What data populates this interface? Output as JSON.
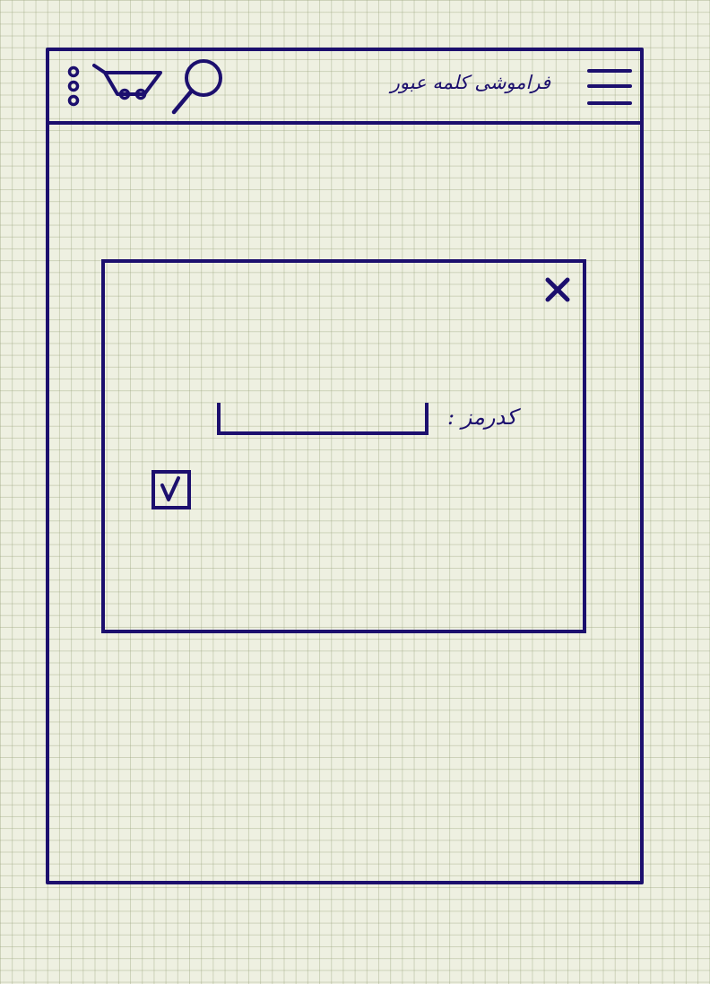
{
  "header": {
    "title": "فراموشی کلمه عبور",
    "icons": [
      "menu-icon",
      "search-icon",
      "cart-icon",
      "more-vertical-icon"
    ]
  },
  "dialog": {
    "close_icon": "close-icon",
    "password_label": "کدرمز :",
    "password_value": "",
    "remember_checkbox_checked": true
  },
  "colors": {
    "ink": "#1c0f6e",
    "paper": "#eef0e1",
    "grid": "#a6ad86"
  }
}
